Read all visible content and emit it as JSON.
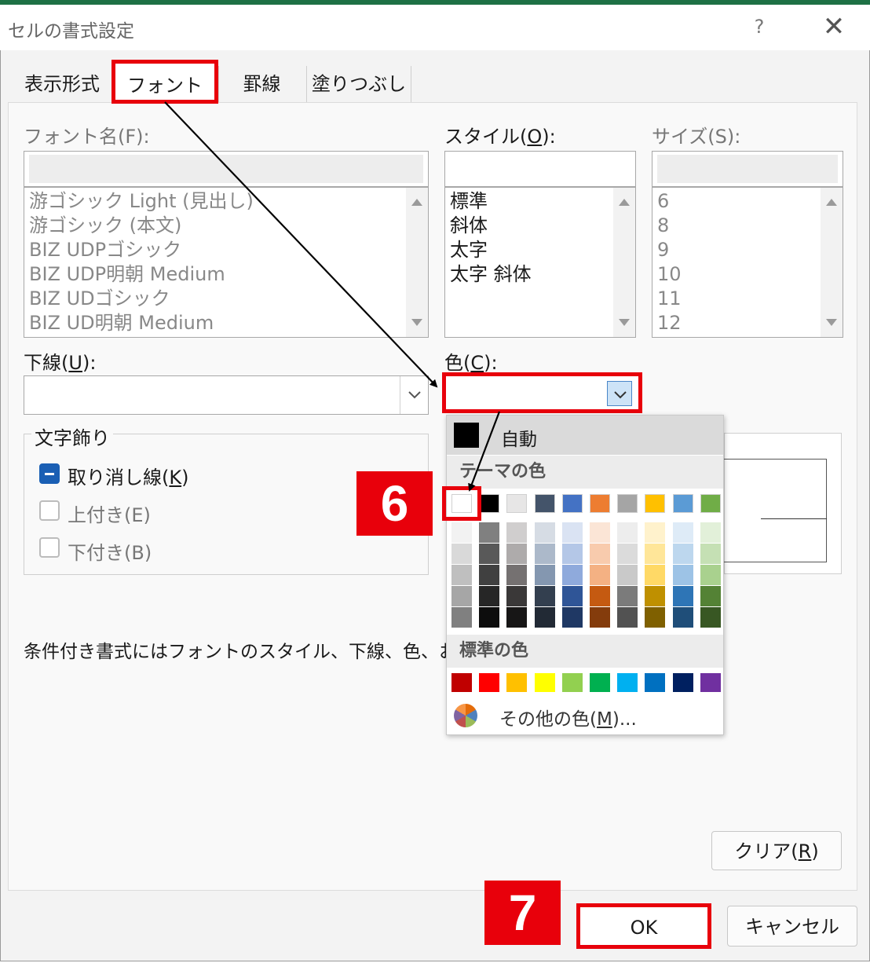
{
  "dialog": {
    "title": "セルの書式設定",
    "help": "?",
    "close": "✕"
  },
  "tabs": [
    {
      "label": "表示形式"
    },
    {
      "label": "フォント"
    },
    {
      "label": "罫線"
    },
    {
      "label": "塗りつぶし"
    }
  ],
  "font": {
    "label_prefix": "フォント名(F):",
    "items": [
      "游ゴシック Light (見出し)",
      "游ゴシック (本文)",
      "BIZ UDPゴシック",
      "BIZ UDP明朝 Medium",
      "BIZ UDゴシック",
      "BIZ UD明朝 Medium"
    ]
  },
  "style": {
    "label_a": "スタイル(",
    "label_key": "O",
    "label_b": "):",
    "items": [
      "標準",
      "斜体",
      "太字",
      "太字 斜体"
    ]
  },
  "size": {
    "label": "サイズ(S):",
    "items": [
      "6",
      "8",
      "9",
      "10",
      "11",
      "12"
    ]
  },
  "underline": {
    "label_a": "下線(",
    "label_key": "U",
    "label_b": "):",
    "value": ""
  },
  "color": {
    "label_a": "色(",
    "label_key": "C",
    "label_b": "):",
    "value": ""
  },
  "effects": {
    "legend": "文字飾り",
    "strikethrough_a": "取り消し線(",
    "strikethrough_key": "K",
    "strikethrough_b": ")",
    "superscript": "上付き(E)",
    "subscript": "下付き(B)",
    "strikethrough_checked": "mixed"
  },
  "note": "条件付き書式にはフォントのスタイル、下線、色、および取",
  "buttons": {
    "clear_a": "クリア(",
    "clear_key": "R",
    "clear_b": ")",
    "ok": "OK",
    "cancel": "キャンセル"
  },
  "color_picker": {
    "auto_label": "自動",
    "theme_label": "テーマの色",
    "standard_label": "標準の色",
    "more_a": "その他の色(",
    "more_key": "M",
    "more_b": ")...",
    "theme_colors": [
      "#ffffff",
      "#000000",
      "#e7e6e6",
      "#44546a",
      "#4472c4",
      "#ed7d31",
      "#a5a5a5",
      "#ffc000",
      "#5b9bd5",
      "#70ad47"
    ],
    "theme_shades": [
      [
        "#f2f2f2",
        "#d9d9d9",
        "#bfbfbf",
        "#a6a6a6",
        "#808080"
      ],
      [
        "#808080",
        "#595959",
        "#404040",
        "#262626",
        "#0d0d0d"
      ],
      [
        "#d0cece",
        "#aeabab",
        "#757171",
        "#3a3838",
        "#171616"
      ],
      [
        "#d6dce4",
        "#acb9ca",
        "#8497b0",
        "#333f4f",
        "#222a35"
      ],
      [
        "#dae3f3",
        "#b4c7e7",
        "#8faadc",
        "#2f5597",
        "#1f3864"
      ],
      [
        "#fbe5d6",
        "#f8cbad",
        "#f4b183",
        "#c55a11",
        "#843c0c"
      ],
      [
        "#ededed",
        "#dbdbdb",
        "#c9c9c9",
        "#7b7b7b",
        "#525252"
      ],
      [
        "#fff2cc",
        "#ffe699",
        "#ffd966",
        "#bf9000",
        "#7f6000"
      ],
      [
        "#deebf7",
        "#bdd7ee",
        "#9dc3e6",
        "#2e75b6",
        "#1f4e79"
      ],
      [
        "#e2f0d9",
        "#c5e0b4",
        "#a9d18e",
        "#548235",
        "#385723"
      ]
    ],
    "standard_colors": [
      "#c00000",
      "#ff0000",
      "#ffc000",
      "#ffff00",
      "#92d050",
      "#00b050",
      "#00b0f0",
      "#0070c0",
      "#002060",
      "#7030a0"
    ]
  },
  "annotations": {
    "step6": "6",
    "step7": "7"
  }
}
